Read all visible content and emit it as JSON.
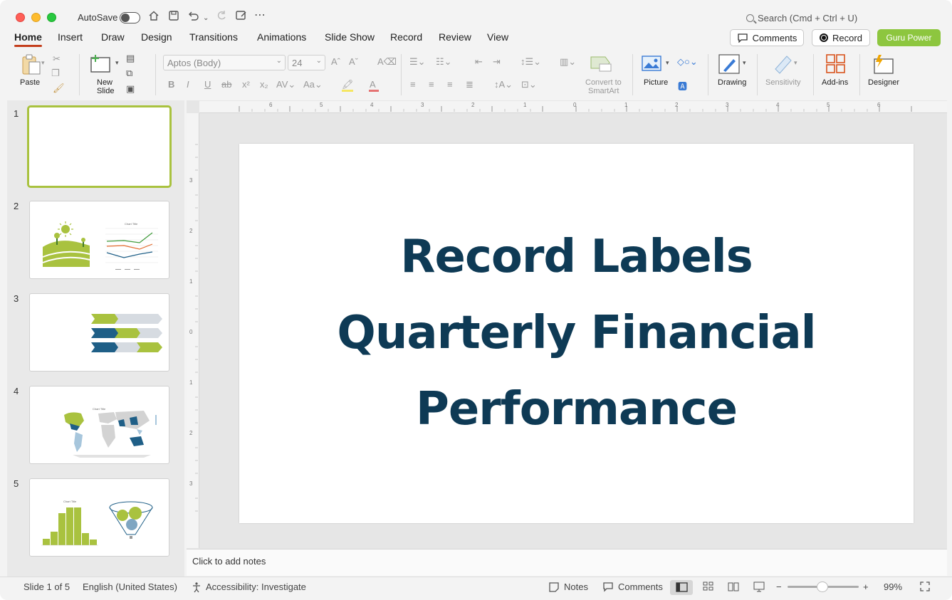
{
  "titlebar": {
    "autosave_label": "AutoSave",
    "search_placeholder": "Search (Cmd + Ctrl + U)"
  },
  "tabs": [
    {
      "label": "Home",
      "active": true
    },
    {
      "label": "Insert"
    },
    {
      "label": "Draw"
    },
    {
      "label": "Design"
    },
    {
      "label": "Transitions"
    },
    {
      "label": "Animations"
    },
    {
      "label": "Slide Show"
    },
    {
      "label": "Record"
    },
    {
      "label": "Review"
    },
    {
      "label": "View"
    }
  ],
  "right_buttons": {
    "comments": "Comments",
    "record": "Record",
    "guru": "Guru Power"
  },
  "ribbon": {
    "paste": "Paste",
    "new_slide_line1": "New",
    "new_slide_line2": "Slide",
    "font_name": "Aptos (Body)",
    "font_size": "24",
    "convert_line1": "Convert to",
    "convert_line2": "SmartArt",
    "picture": "Picture",
    "drawing": "Drawing",
    "sensitivity": "Sensitivity",
    "addins": "Add-ins",
    "designer": "Designer"
  },
  "thumbnails": [
    {
      "num": "1"
    },
    {
      "num": "2",
      "chart_title": "Chart Title"
    },
    {
      "num": "3"
    },
    {
      "num": "4",
      "chart_title": "Chart Title"
    },
    {
      "num": "5",
      "chart_title": "Chart Title"
    }
  ],
  "slide": {
    "title_line1": "Record Labels",
    "title_line2": "Quarterly Financial",
    "title_line3": "Performance"
  },
  "notes_placeholder": "Click to add notes",
  "status": {
    "slide_count": "Slide 1 of 5",
    "language": "English (United States)",
    "accessibility": "Accessibility: Investigate",
    "notes": "Notes",
    "comments": "Comments",
    "zoom": "99%"
  },
  "colors": {
    "title_text": "#0e3a55",
    "accent_green": "#a9c23f",
    "accent_blue": "#1f5f87",
    "tab_underline": "#c43e1c",
    "guru_button": "#8dc63f"
  }
}
